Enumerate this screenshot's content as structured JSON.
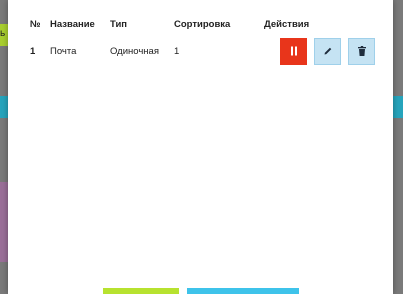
{
  "background": {
    "left_snippet": "ь",
    "colors": {
      "lime": "#a9cf2f",
      "teal": "#26a4bc",
      "purple": "#9a6f98",
      "overlay": "#7a7a7a"
    }
  },
  "table": {
    "columns": [
      "№",
      "Название",
      "Тип",
      "Сортировка",
      "Действия"
    ],
    "rows": [
      {
        "num": "1",
        "name": "Почта",
        "type": "Одиночная",
        "sort": "1"
      }
    ]
  },
  "actions": {
    "pause": {
      "icon": "pause-icon",
      "color": "#e8351b"
    },
    "edit": {
      "icon": "pencil-icon",
      "color": "#c5e3f3",
      "border": "#9fd0ea"
    },
    "delete": {
      "icon": "trash-icon",
      "color": "#c5e3f3",
      "border": "#9fd0ea"
    }
  },
  "footer": {
    "primary_color": "#b7e22f",
    "secondary_color": "#3ec3ea"
  }
}
